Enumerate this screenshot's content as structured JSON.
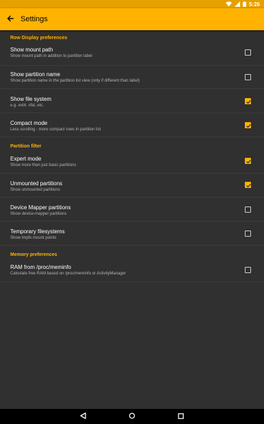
{
  "status_bar": {
    "time": "5:26"
  },
  "app_bar": {
    "title": "Settings"
  },
  "sections": [
    {
      "header": "Row Display preferences",
      "items": [
        {
          "title": "Show mount path",
          "summary": "Show mount path in addition to partition label",
          "checked": false
        },
        {
          "title": "Show partition name",
          "summary": "Show partition name in the partition list view (only if different than label)",
          "checked": false
        },
        {
          "title": "Show file system",
          "summary": "e.g. ext4, vfat, etc.",
          "checked": true
        },
        {
          "title": "Compact mode",
          "summary": "Less scrolling - more compact rows in partition list",
          "checked": true
        }
      ]
    },
    {
      "header": "Partition filter",
      "items": [
        {
          "title": "Expert mode",
          "summary": "Show more than just basic partitions",
          "checked": true
        },
        {
          "title": "Unmounted partitions",
          "summary": "Show unmounted partitions",
          "checked": true
        },
        {
          "title": "Device Mapper partitions",
          "summary": "Show device-mapper partitions",
          "checked": false
        },
        {
          "title": "Temporary filesystems",
          "summary": "Show tmpfs mount points",
          "checked": false
        }
      ]
    },
    {
      "header": "Memory preferences",
      "items": [
        {
          "title": "RAM from /proc/meminfo",
          "summary": "Calculate free RAM based on /proc/meminfo or ActivityManager",
          "checked": false
        }
      ]
    }
  ],
  "colors": {
    "accent": "#ffb300",
    "status_bar": "#e6a100",
    "background": "#303030"
  },
  "icons": [
    "wifi-icon",
    "signal-icon",
    "battery-icon",
    "back-arrow-icon",
    "nav-back-icon",
    "nav-home-icon",
    "nav-recents-icon"
  ]
}
